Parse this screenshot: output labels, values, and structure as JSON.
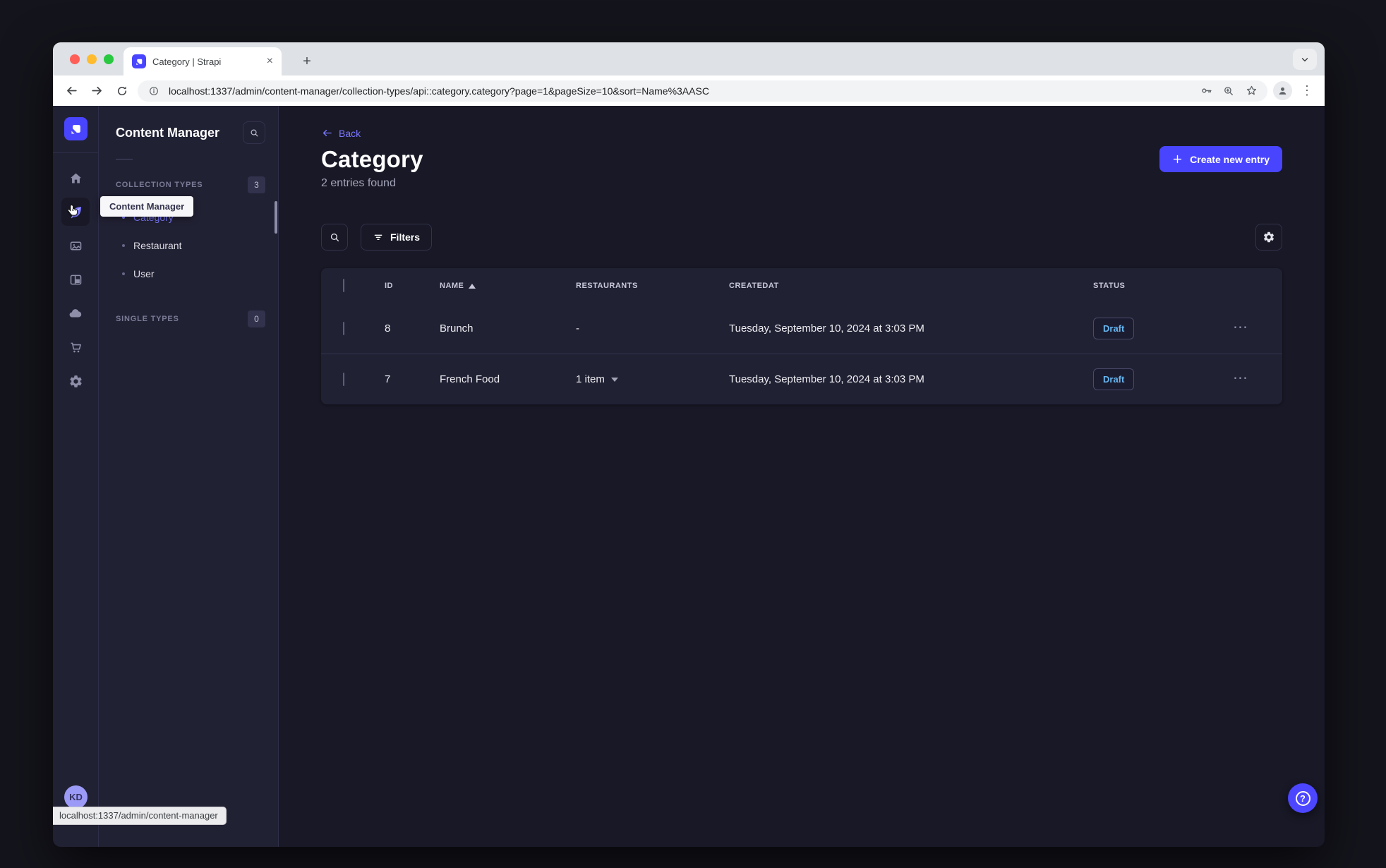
{
  "browser": {
    "tab_title": "Category | Strapi",
    "new_tab": "+",
    "close_tab": "×",
    "url": "localhost:1337/admin/content-manager/collection-types/api::category.category?page=1&pageSize=10&sort=Name%3AASC",
    "status_bubble": "localhost:1337/admin/content-manager",
    "menu_dots": "⋮"
  },
  "nav_rail": {
    "tooltip": "Content Manager",
    "avatar_initials": "KD",
    "icons": [
      "strapi-logo",
      "home",
      "content-manager-feather",
      "media-library",
      "content-type-builder",
      "cloud",
      "marketplace-cart",
      "settings-gear"
    ]
  },
  "subnav": {
    "title": "Content Manager",
    "collection_types": {
      "label": "COLLECTION TYPES",
      "count": "3",
      "items": [
        {
          "label": "Category"
        },
        {
          "label": "Restaurant"
        },
        {
          "label": "User"
        }
      ]
    },
    "single_types": {
      "label": "SINGLE TYPES",
      "count": "0"
    }
  },
  "main": {
    "back_label": "Back",
    "title": "Category",
    "subtitle": "2 entries found",
    "create_button": "Create new entry",
    "filters_button": "Filters",
    "help_icon": "?",
    "table": {
      "headers": {
        "id": "ID",
        "name": "NAME",
        "restaurants": "RESTAURANTS",
        "createdat": "CREATEDAT",
        "status": "STATUS"
      },
      "row_actions_icon": "⋯",
      "rows": [
        {
          "id": "8",
          "name": "Brunch",
          "restaurants": "-",
          "createdat": "Tuesday, September 10, 2024 at 3:03 PM",
          "status": "Draft"
        },
        {
          "id": "7",
          "name": "French Food",
          "restaurants": "1 item",
          "createdat": "Tuesday, September 10, 2024 at 3:03 PM",
          "status": "Draft"
        }
      ]
    }
  },
  "colors": {
    "primary": "#4945ff",
    "primary_text": "#7b79ff",
    "app_background": "#181826",
    "surface": "#212134",
    "border": "#32324d",
    "draft_text": "#66b7f1"
  }
}
